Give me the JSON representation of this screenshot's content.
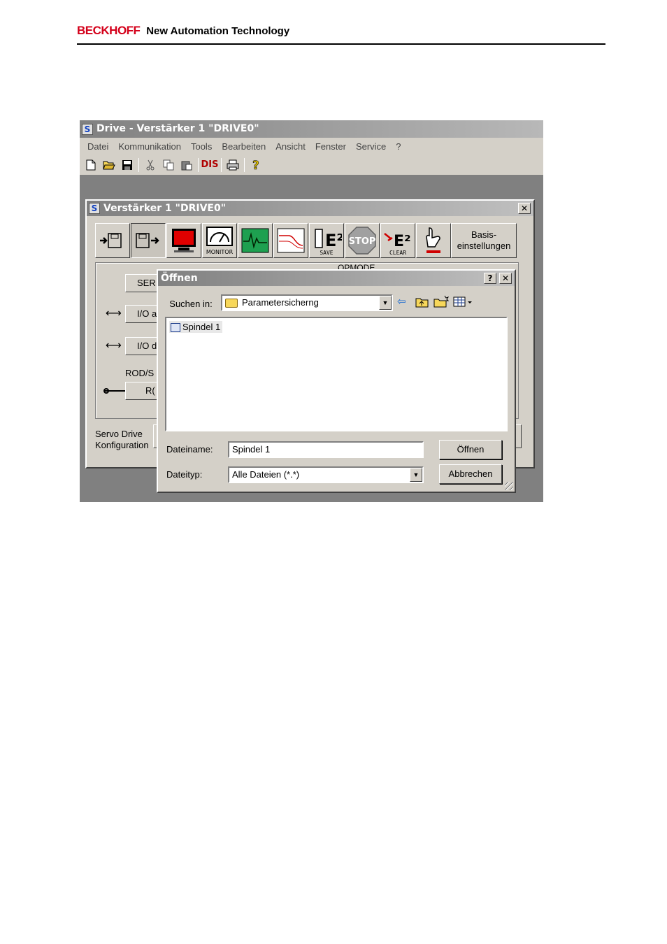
{
  "page_header": {
    "brand": "BECKHOFF",
    "tagline": "New Automation Technology"
  },
  "main_window": {
    "title": "Drive - Verstärker 1 \"DRIVE0\"",
    "menu": [
      "Datei",
      "Kommunikation",
      "Tools",
      "Bearbeiten",
      "Ansicht",
      "Fenster",
      "Service",
      "?"
    ],
    "toolbar": {
      "dis_label": "DIS",
      "icons": [
        "new-file-icon",
        "open-folder-icon",
        "save-icon",
        "cut-icon",
        "copy-icon",
        "paste-icon",
        "print-icon",
        "help-icon"
      ]
    }
  },
  "amp_window": {
    "title": "Verstärker 1 \"DRIVE0\"",
    "close_label": "✕",
    "buttons": {
      "monitor_caption": "MONITOR",
      "save_caption": "SAVE",
      "stop_label": "STOP",
      "clear_caption": "CLEAR",
      "e2_label": "E²",
      "basis_line1": "Basis-",
      "basis_line2": "einstellungen"
    },
    "group": {
      "opmode_label": "OPMODE",
      "ser_button": "SER",
      "io_a_button": "I/O a",
      "io_d_button": "I/O d",
      "rods_label": "ROD/S",
      "ro_button": "R("
    },
    "servo_label_line1": "Servo Drive",
    "servo_label_line2": "Konfiguration"
  },
  "open_dialog": {
    "title": "Öffnen",
    "help_label": "?",
    "close_label": "✕",
    "look_in_label": "Suchen in:",
    "look_in_value": "Parametersicherng",
    "files": [
      {
        "name": "Spindel 1"
      }
    ],
    "filename_label": "Dateiname:",
    "filename_value": "Spindel 1",
    "filetype_label": "Dateityp:",
    "filetype_value": "Alle Dateien (*.*)",
    "open_button": "Öffnen",
    "cancel_button": "Abbrechen"
  },
  "colors": {
    "brand_red": "#d4001a",
    "win_face": "#d4d0c8",
    "desktop_gray": "#808080",
    "monitor_red": "#e00000",
    "scope_green": "#1ea050"
  }
}
